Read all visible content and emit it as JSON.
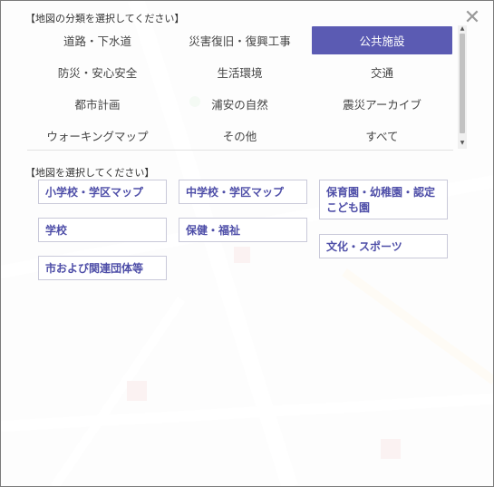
{
  "dialog": {
    "close_symbol": "✕",
    "category_header": "【地図の分類を選択してください】",
    "map_header": "【地図を選択してください】"
  },
  "categories": [
    {
      "label": "道路・下水道"
    },
    {
      "label": "災害復旧・復興工事"
    },
    {
      "label": "公共施設"
    },
    {
      "label": "防災・安心安全"
    },
    {
      "label": "生活環境"
    },
    {
      "label": "交通"
    },
    {
      "label": "都市計画"
    },
    {
      "label": "浦安の自然"
    },
    {
      "label": "震災アーカイブ"
    },
    {
      "label": "ウォーキングマップ"
    },
    {
      "label": "その他"
    },
    {
      "label": "すべて"
    }
  ],
  "active_category": "公共施設",
  "maps": [
    {
      "label": "小学校・学区マップ"
    },
    {
      "label": "中学校・学区マップ"
    },
    {
      "label": "保育園・幼稚園・認定こども園"
    },
    {
      "label": "学校"
    },
    {
      "label": "保健・福祉"
    },
    {
      "label": "文化・スポーツ"
    },
    {
      "label": "市および関連団体等"
    }
  ],
  "colors": {
    "accent": "#5b5bb3",
    "button_text": "#4e4ea8"
  }
}
